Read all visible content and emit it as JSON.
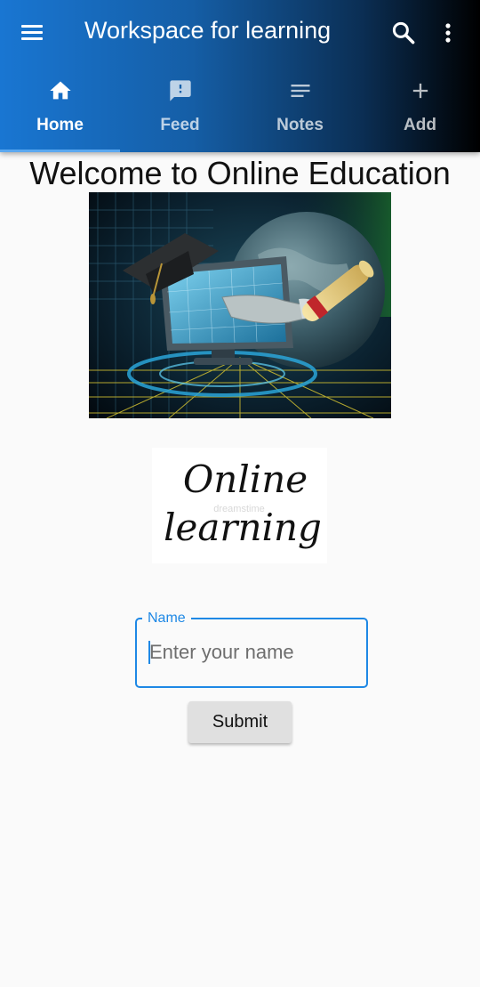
{
  "app_bar": {
    "title": "Workspace for learning",
    "gradient_colors": [
      "#1976d2",
      "#0b2f55",
      "#000000"
    ],
    "icons": {
      "menu": "menu-icon",
      "search": "search-icon",
      "more": "more-vert-icon"
    }
  },
  "tabs": [
    {
      "label": "Home",
      "icon": "home-icon",
      "active": true
    },
    {
      "label": "Feed",
      "icon": "feedback-icon",
      "active": false
    },
    {
      "label": "Notes",
      "icon": "notes-icon",
      "active": false
    },
    {
      "label": "Add",
      "icon": "add-icon",
      "active": false
    }
  ],
  "main": {
    "heading": "Welcome to Online Education",
    "hero_image": "graduation-cap-diploma-computer-image",
    "logo": {
      "line1": "Online",
      "line2": "learning",
      "watermark": "dreamstime"
    },
    "name_field": {
      "label": "Name",
      "placeholder": "Enter your name",
      "value": ""
    },
    "submit_label": "Submit"
  },
  "colors": {
    "accent": "#1e88e5",
    "tab_indicator": "#5aa8f0",
    "background": "#fafafa",
    "button": "#e0e0e0"
  }
}
